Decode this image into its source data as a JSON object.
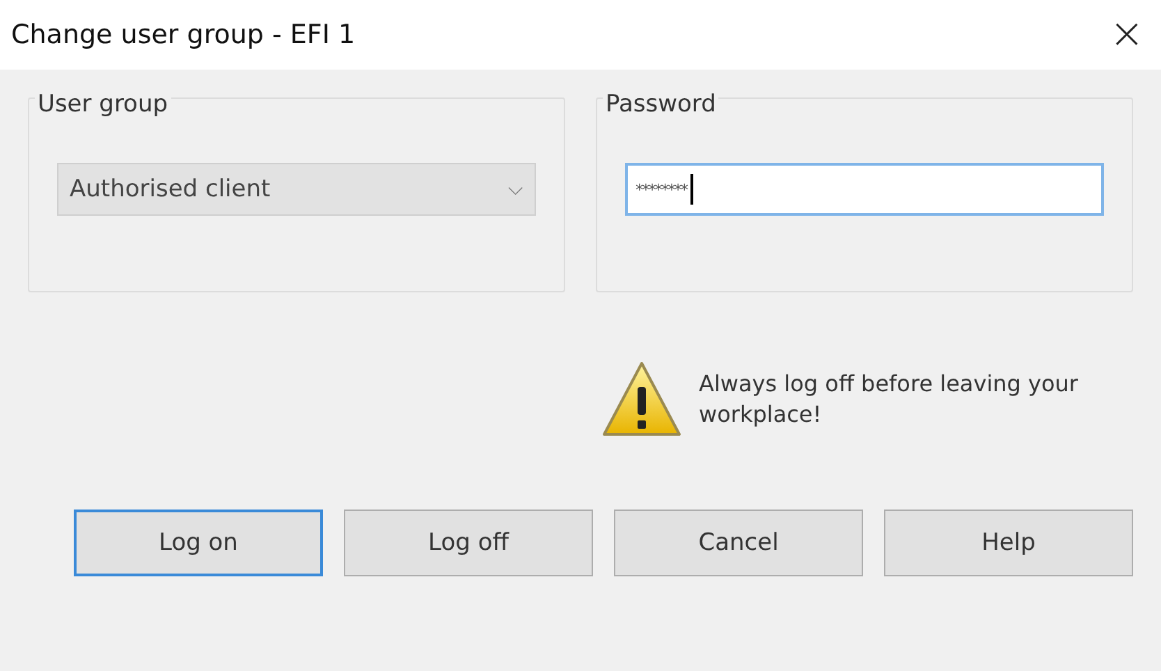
{
  "window": {
    "title": "Change user group - EFI 1",
    "close": "×"
  },
  "user_group": {
    "label": "User group",
    "value": "Authorised client",
    "caret": "⌵"
  },
  "password": {
    "label": "Password",
    "value": "********",
    "focused": true
  },
  "warning": {
    "text": "Always log off before leaving your workplace!"
  },
  "buttons": [
    {
      "label": "Log on",
      "default": true
    },
    {
      "label": "Log off",
      "default": false
    },
    {
      "label": "Cancel",
      "default": false
    },
    {
      "label": "Help",
      "default": false
    }
  ]
}
